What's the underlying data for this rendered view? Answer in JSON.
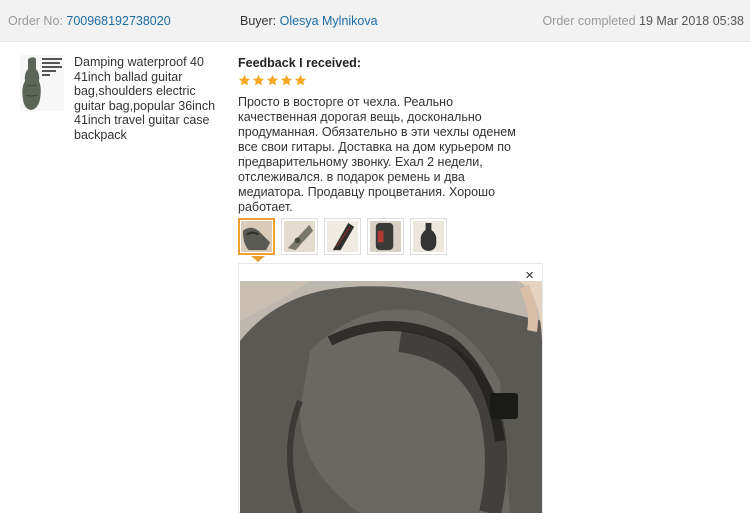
{
  "header": {
    "order_label": "Order No:",
    "order_number": "700968192738020",
    "buyer_label": "Buyer:",
    "buyer_name": "Olesya Mylnikova",
    "status": "Order completed",
    "date": "19 Mar 2018 05:38"
  },
  "product": {
    "title": "Damping waterproof 40 41inch ballad guitar bag,shoulders electric guitar bag,popular 36inch 41inch travel guitar case backpack",
    "thumbnail_icon": "guitar-bag-image"
  },
  "feedback": {
    "heading": "Feedback I received:",
    "rating": 5,
    "rating_max": 5,
    "text": "Просто в восторге от чехла. Реально качественная дорогая вещь, досконально продуманная. Обязательно в эти чехлы оденем все свои гитары. Доставка на дом курьером по предварительному звонку. Ехал 2 недели, отслеживался. в подарок ремень и два медиатора. Продавцу процветания. Хорошо работает.",
    "photos_count": 5,
    "active_photo": 1,
    "close_symbol": "×"
  },
  "colors": {
    "header_bg": "#f2f2f2",
    "link": "#1c6ba4",
    "star": "#f5a623",
    "active_border": "#f0a030"
  }
}
